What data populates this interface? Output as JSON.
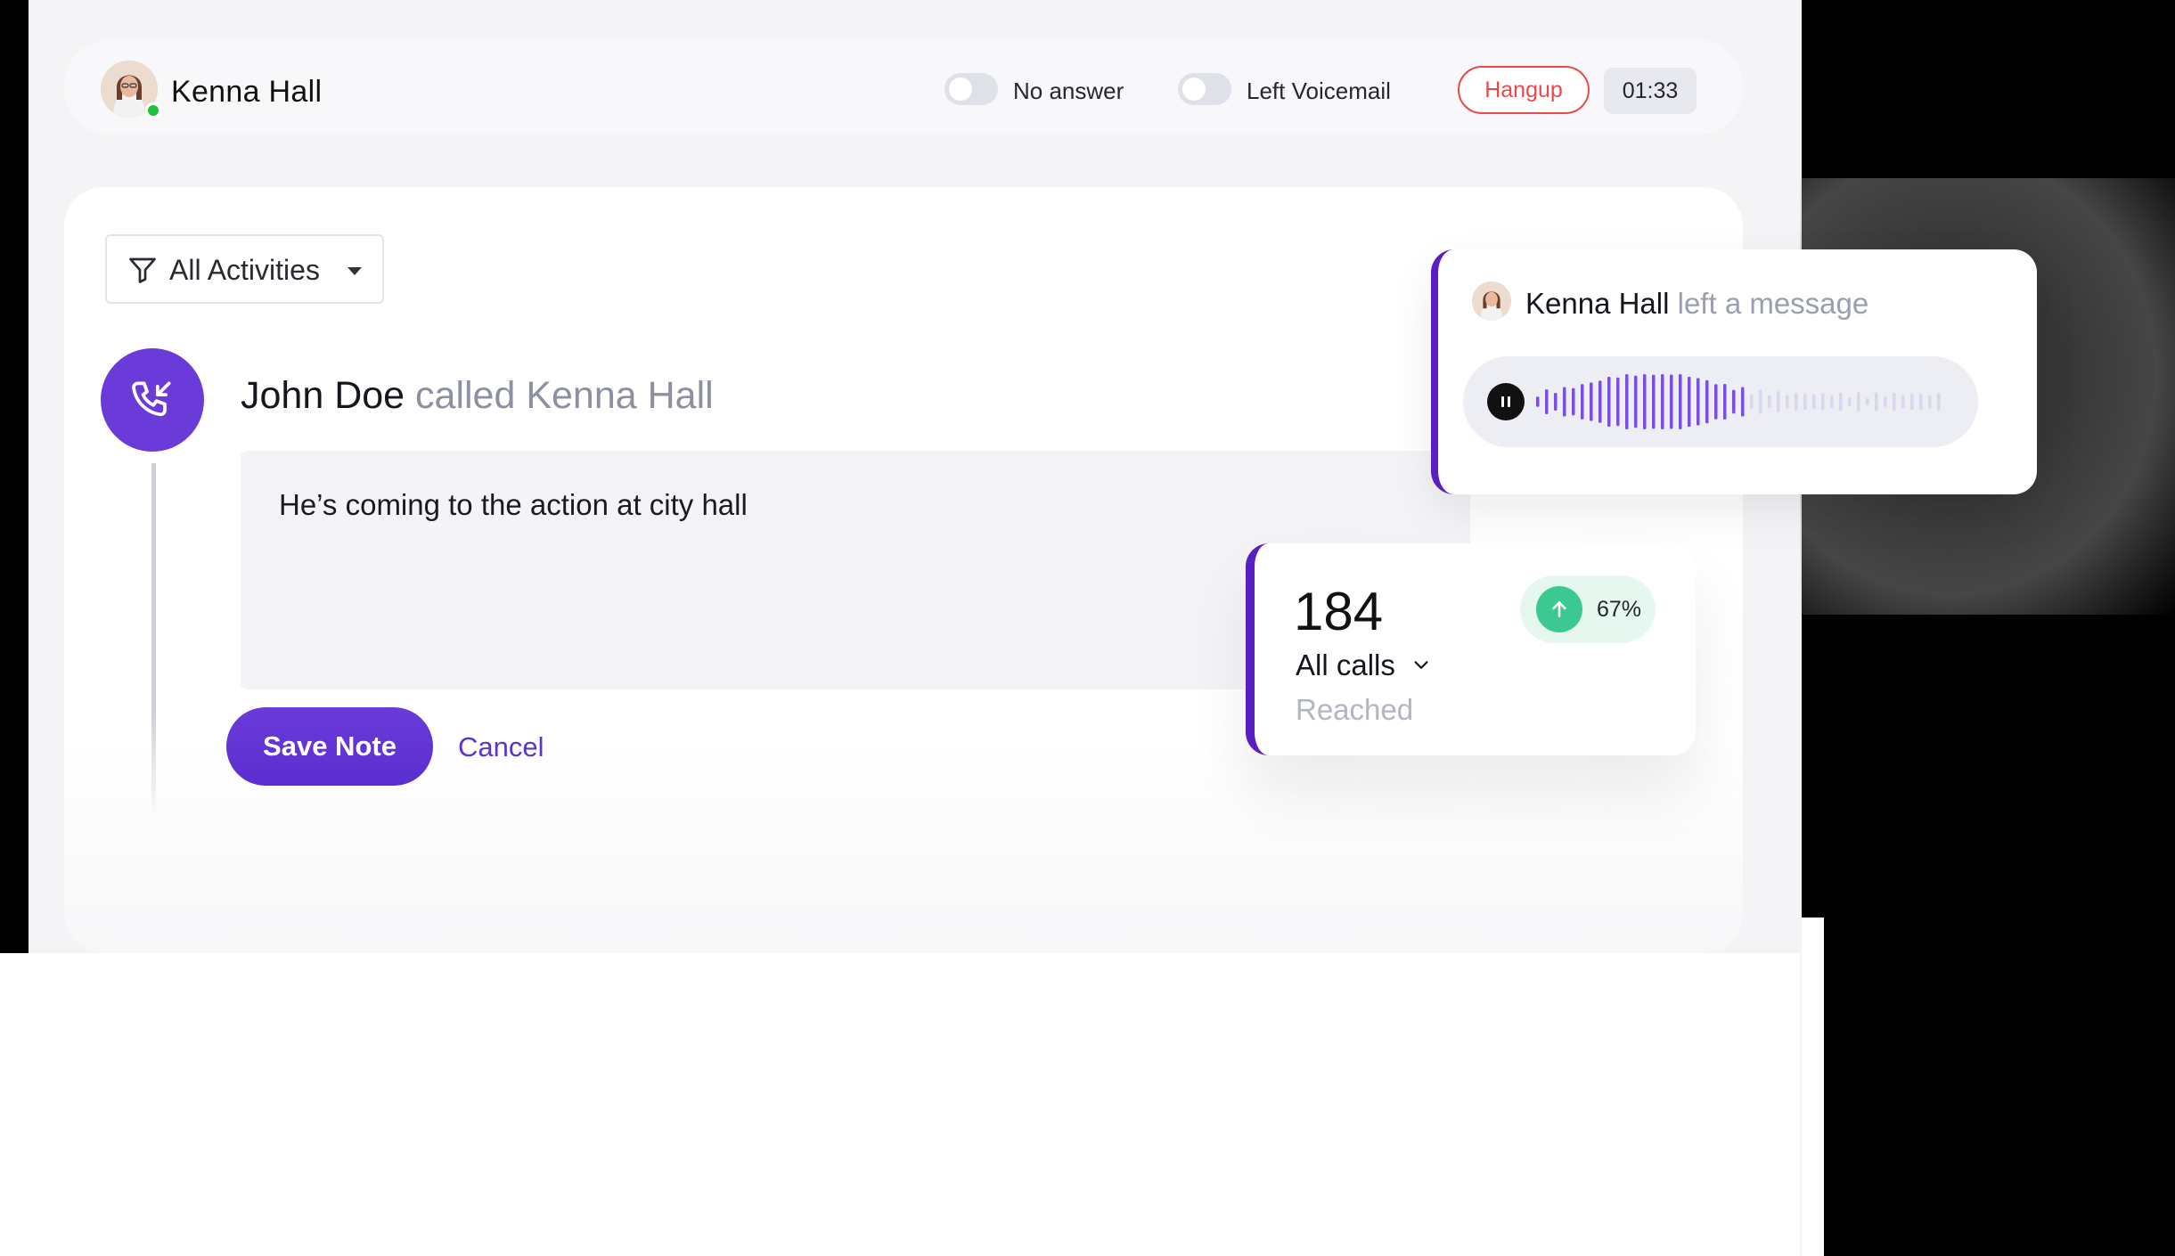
{
  "header": {
    "caller_name": "Kenna Hall",
    "toggles": [
      {
        "label": "No answer",
        "on": false
      },
      {
        "label": "Left Voicemail",
        "on": false
      }
    ],
    "hangup_label": "Hangup",
    "timer": "01:33"
  },
  "filter": {
    "label": "All Activities"
  },
  "activity": {
    "caller": "John Doe",
    "action": "called Kenna Hall",
    "note": "He’s coming to the action at city hall",
    "save_label": "Save Note",
    "cancel_label": "Cancel"
  },
  "voicemail": {
    "who": "Kenna Hall",
    "what": "left a message"
  },
  "stats": {
    "number": "184",
    "label": "All calls",
    "sub": "Reached",
    "trend": "67%"
  },
  "colors": {
    "accent": "#6a3bd9",
    "hangup": "#e84a4a",
    "online": "#1fc236",
    "trend": "#3cc98f"
  }
}
